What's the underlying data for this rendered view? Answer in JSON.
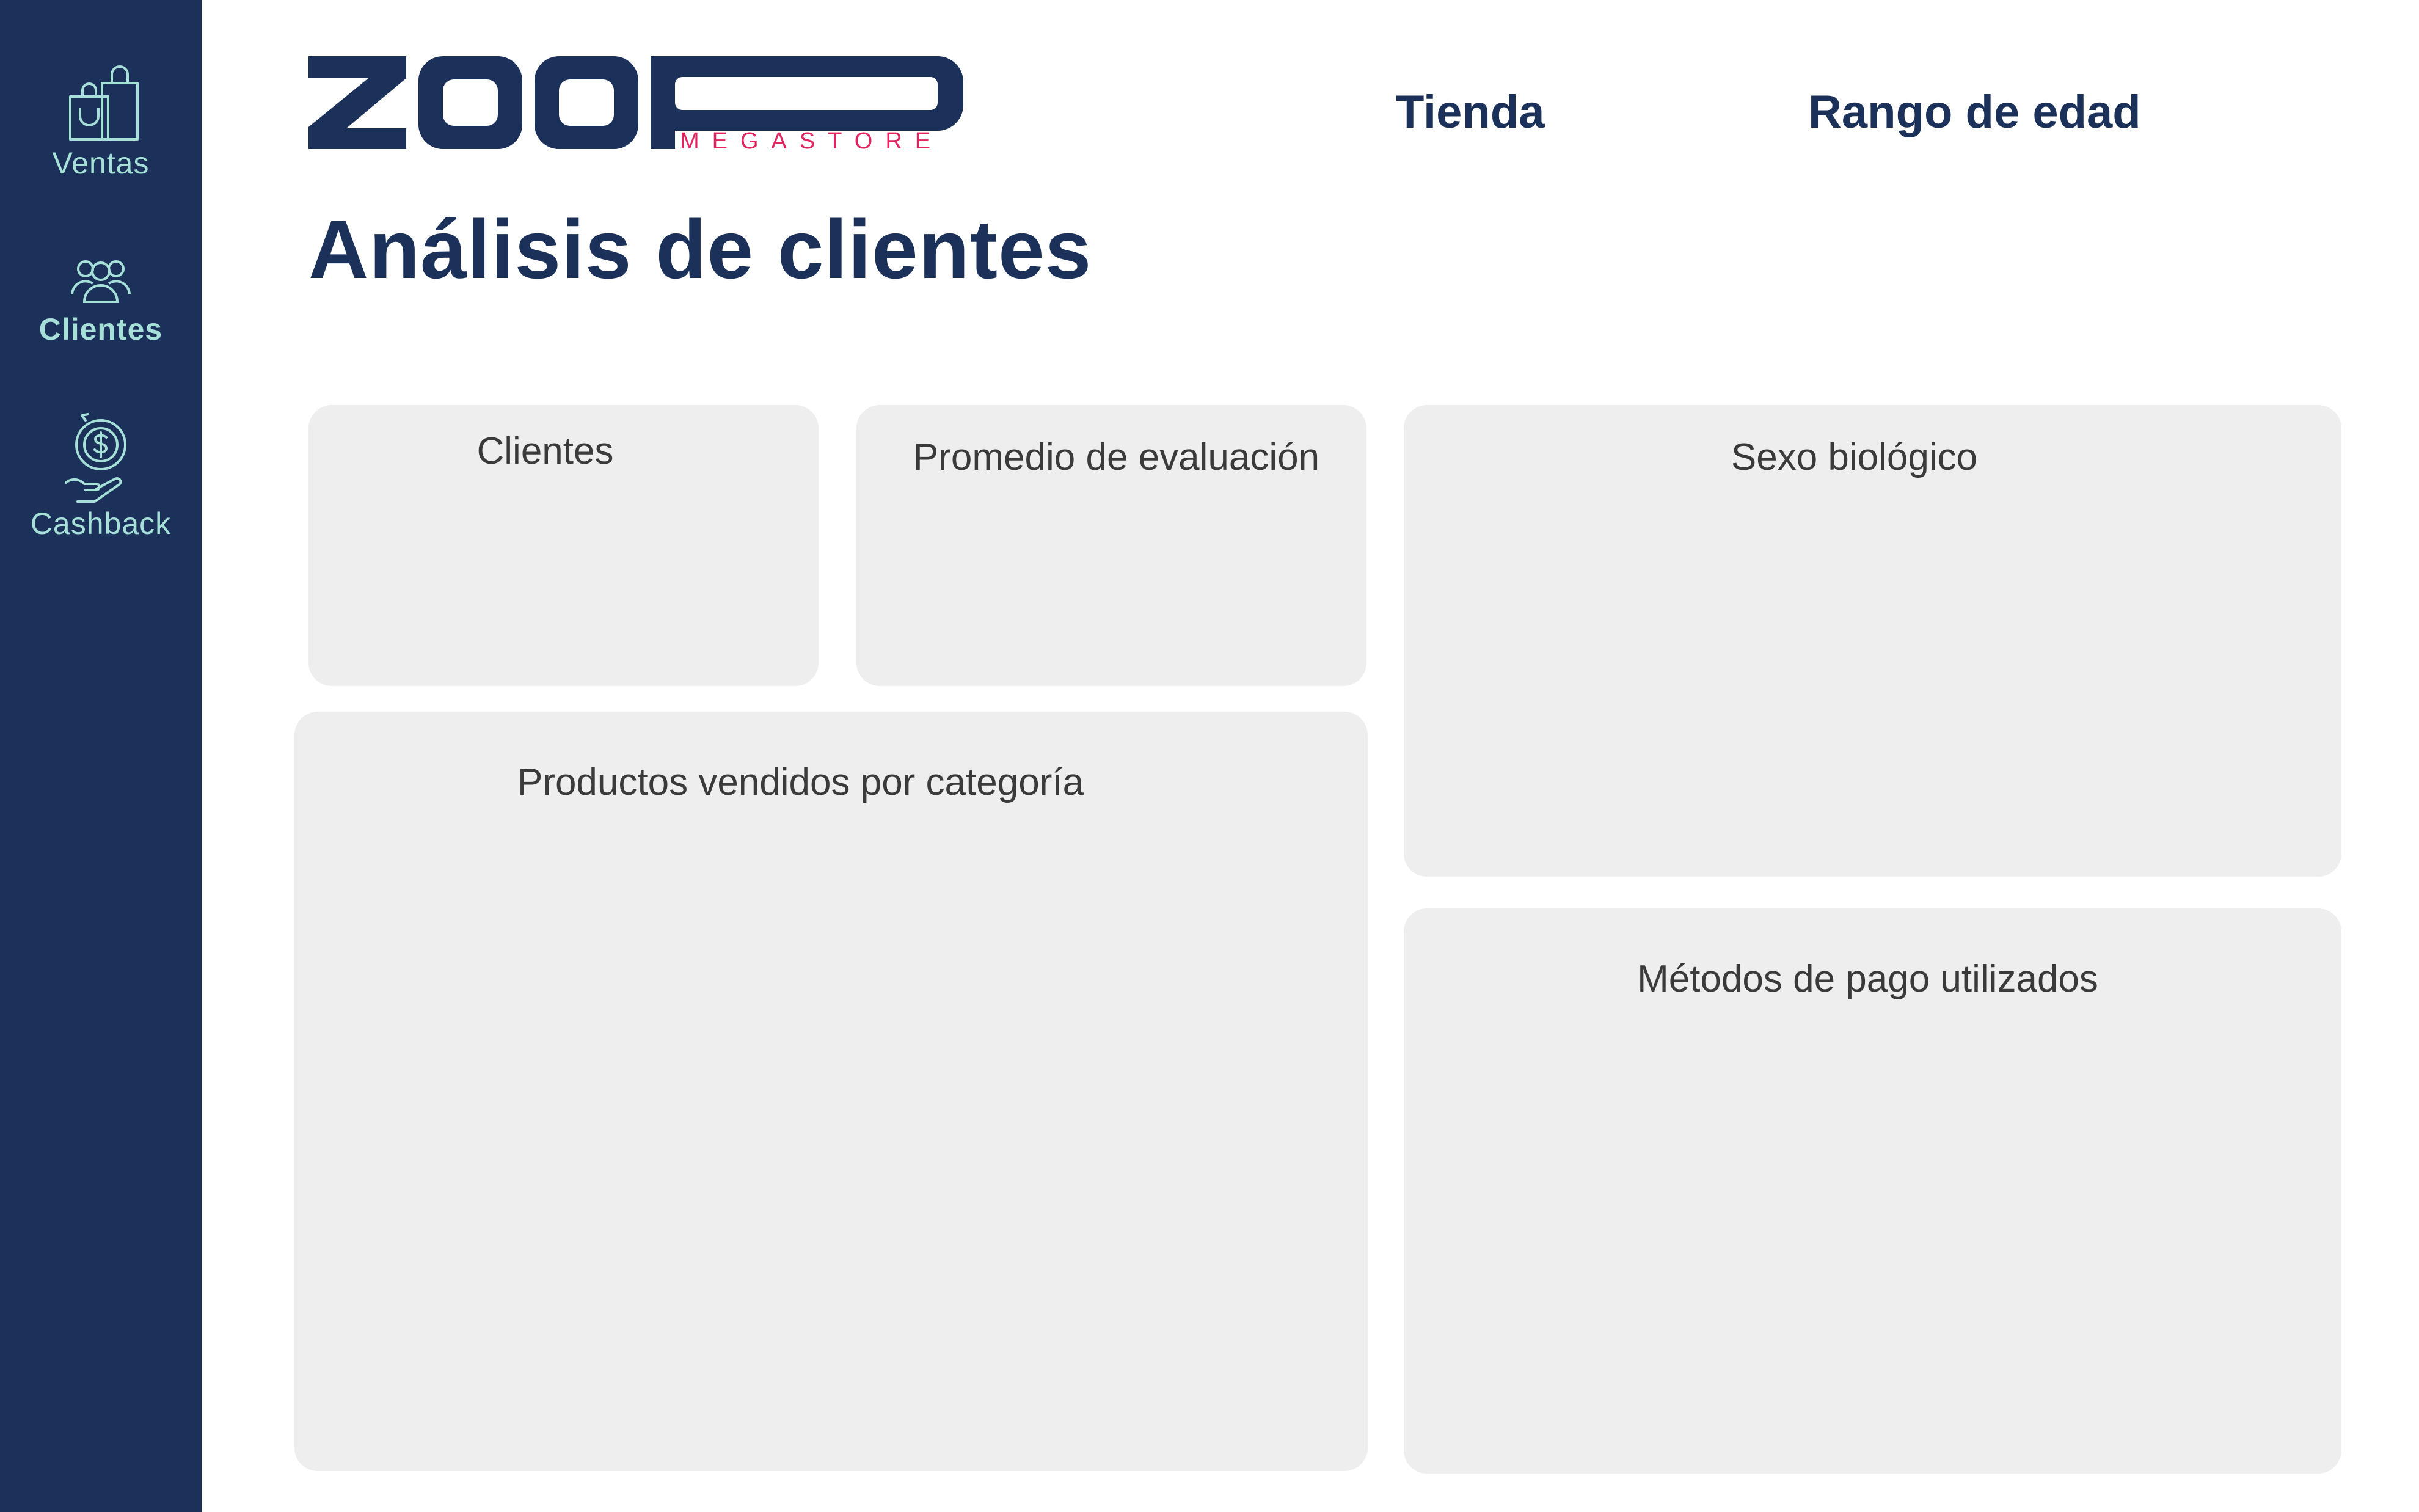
{
  "sidebar": {
    "items": [
      {
        "label": "Ventas",
        "icon": "shopping-bags-icon",
        "active": false
      },
      {
        "label": "Clientes",
        "icon": "users-group-icon",
        "active": true
      },
      {
        "label": "Cashback",
        "icon": "hand-dollar-coin-icon",
        "active": false
      }
    ]
  },
  "header": {
    "logo": {
      "brand": "ZOOP",
      "subtitle": "MEGASTORE"
    },
    "filters": {
      "store_label": "Tienda",
      "age_range_label": "Rango de edad"
    }
  },
  "page": {
    "title": "Análisis de clientes"
  },
  "cards": {
    "customers": {
      "title": "Clientes"
    },
    "rating_avg": {
      "title": "Promedio de evaluación"
    },
    "sex": {
      "title": "Sexo biológico"
    },
    "products_by_category": {
      "title": "Productos vendidos por categoría"
    },
    "payment_methods": {
      "title": "Métodos de pago utilizados"
    }
  },
  "colors": {
    "sidebar_bg": "#1b3159",
    "sidebar_accent": "#a6e0d8",
    "brand_navy": "#1b3159",
    "brand_pink": "#e0245e",
    "card_bg": "#eeeeee",
    "card_text": "#3a3a3a"
  }
}
